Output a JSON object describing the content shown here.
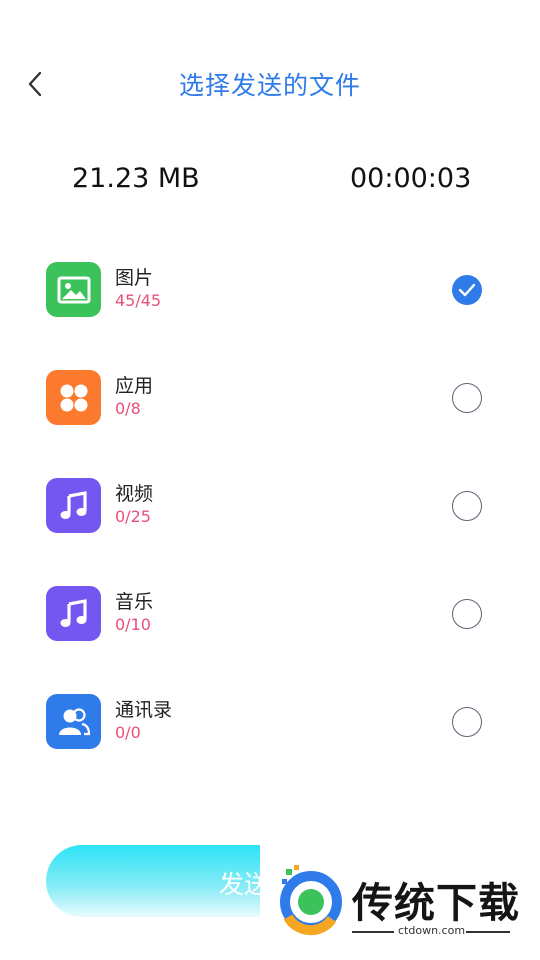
{
  "header": {
    "title": "选择发送的文件",
    "back_icon": "chevron-left-icon"
  },
  "stats": {
    "size": "21.23 MB",
    "time": "00:00:03"
  },
  "categories": [
    {
      "name": "图片",
      "count": "45/45",
      "icon": "image-icon",
      "color": "#3bc25b",
      "checked": true
    },
    {
      "name": "应用",
      "count": "0/8",
      "icon": "apps-icon",
      "color": "#fb7a2e",
      "checked": false
    },
    {
      "name": "视频",
      "count": "0/25",
      "icon": "music-note-icon",
      "color": "#7456f0",
      "checked": false
    },
    {
      "name": "音乐",
      "count": "0/10",
      "icon": "music-note-icon",
      "color": "#7456f0",
      "checked": false
    },
    {
      "name": "通讯录",
      "count": "0/0",
      "icon": "contacts-icon",
      "color": "#2f7bea",
      "checked": false
    }
  ],
  "send_button": {
    "label": "发送"
  },
  "watermark": {
    "text": "传统下载",
    "url": "ctdown.com"
  },
  "colors": {
    "accent": "#2f7bea",
    "count_text": "#e8507a"
  }
}
